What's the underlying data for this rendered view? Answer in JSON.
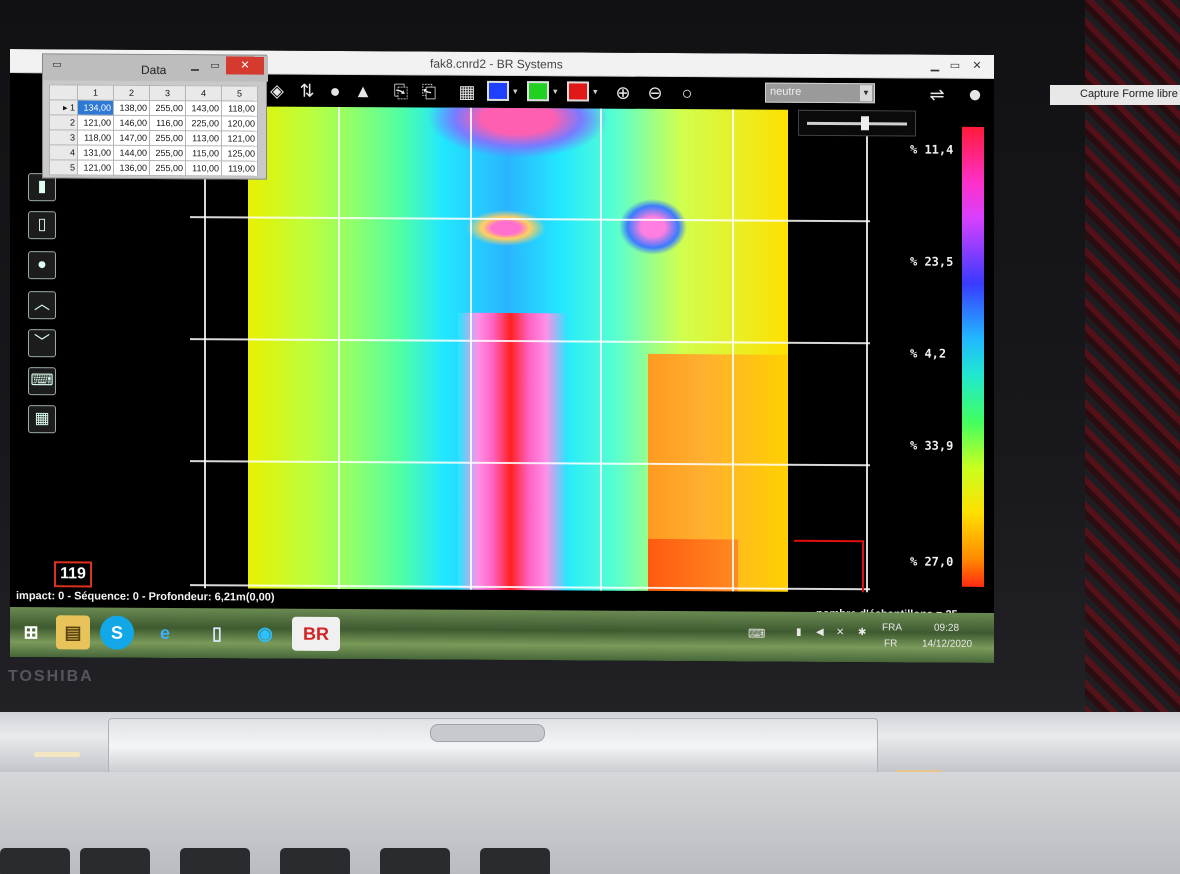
{
  "window": {
    "title": "fak8.cnrd2 - BR Systems"
  },
  "data_window": {
    "title": "Data",
    "columns": [
      "1",
      "2",
      "3",
      "4",
      "5"
    ],
    "rows": [
      {
        "label": "1",
        "cells": [
          "134,00",
          "138,00",
          "255,00",
          "143,00",
          "118,00"
        ]
      },
      {
        "label": "2",
        "cells": [
          "121,00",
          "146,00",
          "116,00",
          "225,00",
          "120,00"
        ]
      },
      {
        "label": "3",
        "cells": [
          "118,00",
          "147,00",
          "255,00",
          "113,00",
          "121,00"
        ]
      },
      {
        "label": "4",
        "cells": [
          "131,00",
          "144,00",
          "255,00",
          "115,00",
          "125,00"
        ]
      },
      {
        "label": "5",
        "cells": [
          "121,00",
          "136,00",
          "255,00",
          "110,00",
          "119,00"
        ]
      }
    ],
    "selected_cell": "134,00"
  },
  "toolbar": {
    "color_swatches": [
      "#1f3fff",
      "#22d022",
      "#e11818"
    ],
    "mode_select": "neutre"
  },
  "legend": {
    "labels": [
      "% 11,4",
      "% 23,5",
      "% 4,2",
      "% 33,9",
      "% 27,0"
    ]
  },
  "sample_value": "119",
  "status": {
    "left": "impact: 0 - Séquence: 0 - Profondeur: 6,21m(0,00)",
    "right": "nombre d'échantillons = 25"
  },
  "taskbar": {
    "language": "FRA",
    "region": "FR",
    "time": "09:28",
    "date": "14/12/2020",
    "apps": [
      "windows-start",
      "file-explorer",
      "skype",
      "internet-explorer",
      "notepad",
      "edge",
      "br-systems"
    ],
    "br_label": "BR"
  },
  "capture_tooltip": "Capture Forme libre",
  "device_brand": "TOSHIBA"
}
